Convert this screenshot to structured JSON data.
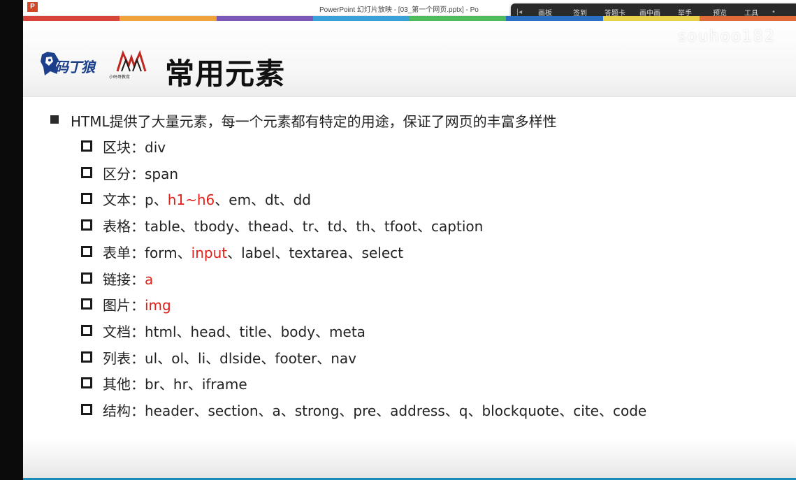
{
  "window": {
    "title": "PowerPoint 幻灯片放映 - [03_第一个网页.pptx] - Po",
    "logo_text": "P"
  },
  "toolbar": {
    "arrow": "|◂",
    "items": [
      "画板",
      "签到",
      "答题卡",
      "画中画",
      "举手",
      "预览",
      "工具"
    ],
    "overflow": "•"
  },
  "user": {
    "name": "souhoo182"
  },
  "colors": {
    "accent_red": "#e0201a",
    "brand_blue": "#1c3f8c",
    "logo_red": "#c0271f",
    "bar": [
      "#d9443a",
      "#f0a33b",
      "#7b57b6",
      "#3aa0d8",
      "#4fbc5c",
      "#2b6fc4",
      "#e9d24a",
      "#e06a3a"
    ]
  },
  "logos": {
    "brand1_text": "码丁狼",
    "brand2_sub": "小码哥教育",
    "brand1_icon": "wolf-head-icon",
    "brand2_icon": "mm-logo-icon"
  },
  "slide": {
    "title": "常用元素",
    "main_bullet": "HTML提供了大量元素，每一个元素都有特定的用途，保证了网页的丰富多样性",
    "items": [
      {
        "segments": [
          {
            "text": "区块：div",
            "red": false
          }
        ]
      },
      {
        "segments": [
          {
            "text": "区分：span",
            "red": false
          }
        ]
      },
      {
        "segments": [
          {
            "text": "文本：p、",
            "red": false
          },
          {
            "text": "h1~h6",
            "red": true
          },
          {
            "text": "、em、dt、dd",
            "red": false
          }
        ]
      },
      {
        "segments": [
          {
            "text": "表格：table、tbody、thead、tr、td、th、tfoot、caption",
            "red": false
          }
        ]
      },
      {
        "segments": [
          {
            "text": "表单：form、",
            "red": false
          },
          {
            "text": "input",
            "red": true
          },
          {
            "text": "、label、textarea、select",
            "red": false
          }
        ]
      },
      {
        "segments": [
          {
            "text": "链接：",
            "red": false
          },
          {
            "text": "a",
            "red": true
          }
        ]
      },
      {
        "segments": [
          {
            "text": "图片：",
            "red": false
          },
          {
            "text": "img",
            "red": true
          }
        ]
      },
      {
        "segments": [
          {
            "text": "文档：html、head、title、body、meta",
            "red": false
          }
        ]
      },
      {
        "segments": [
          {
            "text": "列表：ul、ol、li、dlside、footer、nav",
            "red": false
          }
        ]
      },
      {
        "segments": [
          {
            "text": "其他：br、hr、iframe",
            "red": false
          }
        ]
      },
      {
        "segments": [
          {
            "text": "结构：header、section、a、strong、pre、address、q、blockquote、cite、code",
            "red": false
          }
        ]
      }
    ]
  }
}
